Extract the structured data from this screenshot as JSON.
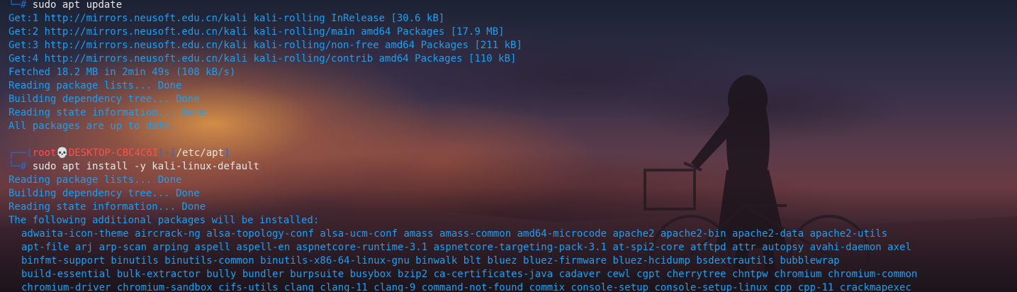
{
  "terminal": {
    "block1": {
      "prompt_tail": "└─",
      "hash": "#",
      "command": " sudo apt update",
      "output": [
        "Get:1 http://mirrors.neusoft.edu.cn/kali kali-rolling InRelease [30.6 kB]",
        "Get:2 http://mirrors.neusoft.edu.cn/kali kali-rolling/main amd64 Packages [17.9 MB]",
        "Get:3 http://mirrors.neusoft.edu.cn/kali kali-rolling/non-free amd64 Packages [211 kB]",
        "Get:4 http://mirrors.neusoft.edu.cn/kali kali-rolling/contrib amd64 Packages [110 kB]",
        "Fetched 18.2 MB in 2min 49s (108 kB/s)",
        "Reading package lists... Done",
        "Building dependency tree... Done",
        "Reading state information... Done",
        "All packages are up to date."
      ]
    },
    "block2": {
      "prompt_head": "┌──(",
      "user": "root💀DESKTOP-CBC4C6I",
      "sep": ")-[",
      "path": "/etc/apt",
      "close": "]",
      "prompt_tail": "└─",
      "hash": "#",
      "command": " sudo apt install -y kali-linux-default",
      "output": [
        "Reading package lists... Done",
        "Building dependency tree... Done",
        "Reading state information... Done",
        "The following additional packages will be installed:"
      ],
      "packages": [
        "adwaita-icon-theme aircrack-ng alsa-topology-conf alsa-ucm-conf amass amass-common amd64-microcode apache2 apache2-bin apache2-data apache2-utils",
        "apt-file arj arp-scan arping aspell aspell-en aspnetcore-runtime-3.1 aspnetcore-targeting-pack-3.1 at-spi2-core atftpd attr autopsy avahi-daemon axel",
        "binfmt-support binutils binutils-common binutils-x86-64-linux-gnu binwalk blt bluez bluez-firmware bluez-hcidump bsdextrautils bubblewrap",
        "build-essential bulk-extractor bully bundler burpsuite busybox bzip2 ca-certificates-java cadaver cewl cgpt cherrytree chntpw chromium chromium-common",
        "chromium-driver chromium-sandbox cifs-utils clang clang-11 clang-9 command-not-found commix console-setup console-setup-linux cpp cpp-11 crackmapexec"
      ]
    }
  }
}
